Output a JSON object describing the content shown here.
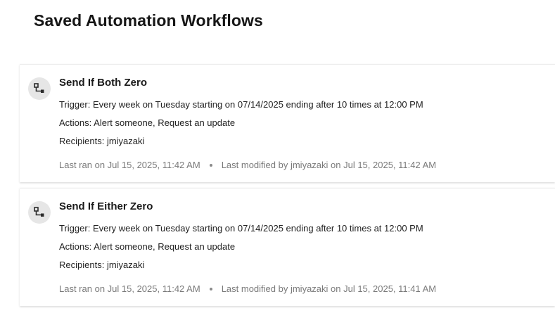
{
  "page": {
    "title": "Saved Automation Workflows"
  },
  "workflows": [
    {
      "icon": "workflow-diagram-icon",
      "name": "Send If Both Zero",
      "trigger_label": "Trigger:",
      "trigger": "Every week on Tuesday starting on 07/14/2025 ending after 10 times at 12:00 PM",
      "actions_label": "Actions:",
      "actions": "Alert someone, Request an update",
      "recipients_label": "Recipients:",
      "recipients": "jmiyazaki",
      "last_ran": "Last ran on Jul 15, 2025, 11:42 AM",
      "last_modified": "Last modified by jmiyazaki on Jul 15, 2025, 11:42 AM"
    },
    {
      "icon": "workflow-diagram-icon",
      "name": "Send If Either Zero",
      "trigger_label": "Trigger:",
      "trigger": "Every week on Tuesday starting on 07/14/2025 ending after 10 times at 12:00 PM",
      "actions_label": "Actions:",
      "actions": "Alert someone, Request an update",
      "recipients_label": "Recipients:",
      "recipients": "jmiyazaki",
      "last_ran": "Last ran on Jul 15, 2025, 11:42 AM",
      "last_modified": "Last modified by jmiyazaki on Jul 15, 2025, 11:41 AM"
    }
  ]
}
